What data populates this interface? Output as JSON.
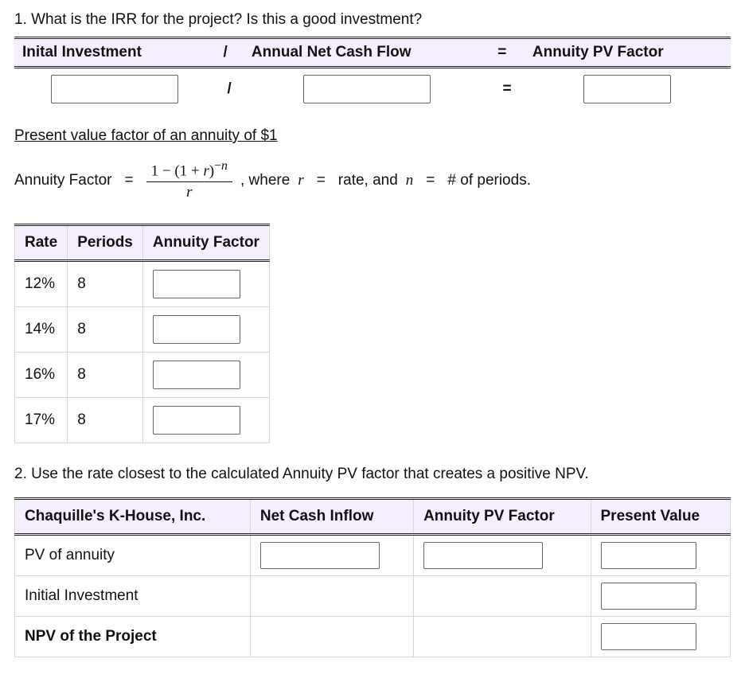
{
  "q1": "1. What is the IRR for the project? Is this a good investment?",
  "tbl1": {
    "h1": "Inital Investment",
    "op1": "/",
    "h2": "Annual Net Cash Flow",
    "op2": "=",
    "h3": "Annuity PV Factor",
    "row_op1": "/",
    "row_op2": "="
  },
  "formula": {
    "title": "Present value factor of an annuity of $1",
    "lhs": "Annuity Factor",
    "eq1": "=",
    "num_prefix": "1 − (1 + ",
    "num_r": "r",
    "num_suffix": ")",
    "exp_prefix": "−",
    "exp_n": "n",
    "den": "r",
    "comma_where": ", where ",
    "r_var": "r",
    "eq2": "=",
    "rate_txt": "rate, and ",
    "n_var": "n",
    "eq3": "=",
    "periods_txt": "# of periods."
  },
  "tbl2": {
    "h1": "Rate",
    "h2": "Periods",
    "h3": "Annuity Factor",
    "rows": [
      {
        "rate": "12%",
        "periods": "8"
      },
      {
        "rate": "14%",
        "periods": "8"
      },
      {
        "rate": "16%",
        "periods": "8"
      },
      {
        "rate": "17%",
        "periods": "8"
      }
    ]
  },
  "q2": "2. Use the rate closest to the calculated Annuity PV factor that creates a positive NPV.",
  "tbl3": {
    "h1": "Chaquille's K-House, Inc.",
    "h2": "Net Cash Inflow",
    "h3": "Annuity PV Factor",
    "h4": "Present Value",
    "rows": [
      {
        "label": "PV of annuity",
        "bold": false,
        "has_ci": true,
        "has_af": true,
        "has_pv": true
      },
      {
        "label": "Initial Investment",
        "bold": false,
        "has_ci": false,
        "has_af": false,
        "has_pv": true
      },
      {
        "label": "NPV of the Project",
        "bold": true,
        "has_ci": false,
        "has_af": false,
        "has_pv": true
      }
    ]
  }
}
